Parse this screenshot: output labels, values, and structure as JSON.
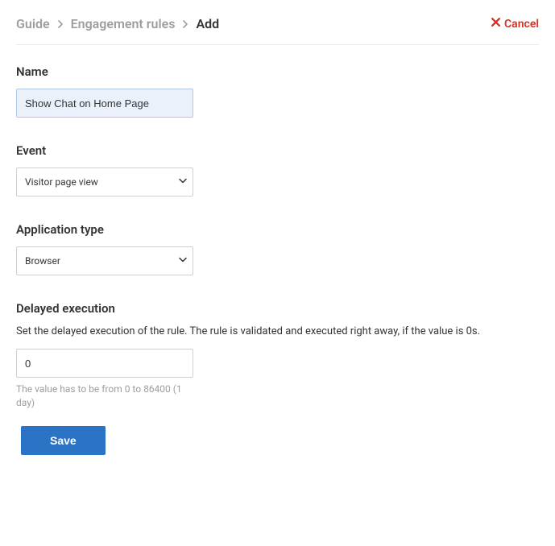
{
  "breadcrumb": {
    "items": [
      {
        "label": "Guide"
      },
      {
        "label": "Engagement rules"
      },
      {
        "label": "Add"
      }
    ]
  },
  "header": {
    "cancel_label": "Cancel"
  },
  "form": {
    "name": {
      "label": "Name",
      "value": "Show Chat on Home Page"
    },
    "event": {
      "label": "Event",
      "value": "Visitor page view"
    },
    "application_type": {
      "label": "Application type",
      "value": "Browser"
    },
    "delayed_execution": {
      "label": "Delayed execution",
      "description": "Set the delayed execution of the rule. The rule is validated and executed right away, if the value is 0s.",
      "value": "0",
      "help_text": "The value has to be from 0 to 86400 (1 day)"
    },
    "save_label": "Save"
  }
}
